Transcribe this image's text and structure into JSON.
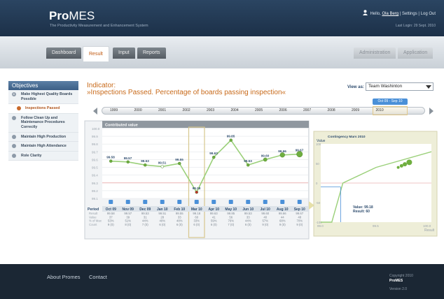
{
  "header": {
    "logo_bold": "Pro",
    "logo_light": "MES",
    "tagline": "The Productivity Measurement and Enhancement System",
    "hello": "Hello,",
    "user": "Ola Berg",
    "sep": "|",
    "settings": "Settings",
    "logout": "Log Out",
    "last_login": "Last Login: 29 Sept. 2010"
  },
  "tabs": {
    "dashboard": "Dashboard",
    "result": "Result",
    "input": "Input",
    "reports": "Reports",
    "administration": "Administration",
    "application": "Application"
  },
  "sidebar": {
    "title": "Objectives",
    "items": [
      {
        "label": "Make Highest Quality Boards Possible",
        "marker": "C"
      },
      {
        "label": "Inspections Passed",
        "marker": ""
      },
      {
        "label": "Follow Clean Up and Maintenance Procedures Correctly",
        "marker": ""
      },
      {
        "label": "Maintain High Production",
        "marker": ""
      },
      {
        "label": "Maintain High Attendance",
        "marker": ""
      },
      {
        "label": "Role Clarity",
        "marker": ""
      }
    ]
  },
  "indicator": {
    "label": "Indicator:",
    "title": "»Inspections Passed. Percentage of boards passing inspection«"
  },
  "view": {
    "label": "View as:",
    "value": "Team Washinton"
  },
  "timeline": {
    "years": [
      "1999",
      "2000",
      "2001",
      "2002",
      "2003",
      "2004",
      "2005",
      "2006",
      "2007",
      "2008",
      "2009",
      "2010"
    ],
    "badge": "Oct 09 - Sep 10"
  },
  "chart_data": [
    {
      "type": "line",
      "title": "Contributed value",
      "categories": [
        "Oct 09",
        "Nov 09",
        "Dec 09",
        "Jan 10",
        "Feb 10",
        "Mar 10",
        "Apr 10",
        "May 10",
        "Jun 10",
        "Jul 10",
        "Aug 10",
        "Sep 10"
      ],
      "values": [
        99.58,
        99.57,
        99.53,
        99.51,
        99.55,
        99.18,
        99.63,
        99.85,
        99.53,
        99.6,
        99.66,
        99.67
      ],
      "ylim": [
        99.1,
        100.0
      ],
      "yticks": [
        "100.0",
        "99.9",
        "99.8",
        "99.7",
        "99.6",
        "99.5",
        "99.4",
        "99.3",
        "99.2",
        "99.1"
      ],
      "highlight": "Mar 10",
      "table": {
        "row_labels": [
          "Period",
          "Result",
          "Value",
          "% of Max",
          "Count"
        ],
        "result": [
          "99.58",
          "99.57",
          "99.53",
          "99.51",
          "99.55",
          "99.18",
          "99.63",
          "99.85",
          "99.53",
          "99.60",
          "99.66",
          "99.67"
        ],
        "value": [
          "37",
          "39",
          "31",
          "28",
          "33",
          "60",
          "41",
          "56",
          "33",
          "40",
          "44",
          "48"
        ],
        "pct_max": [
          "53%",
          "51%",
          "44%",
          "40%",
          "48%",
          "33%",
          "59%",
          "76%",
          "44%",
          "57%",
          "68%",
          "70%"
        ],
        "count": [
          "9 (0)",
          "8 (0)",
          "7 (0)",
          "6 (0)",
          "6 (0)",
          "6 (0)",
          "6 (0)",
          "7 (0)",
          "6 (0)",
          "9 (0)",
          "9 (0)",
          "9 (0)"
        ]
      }
    },
    {
      "type": "line",
      "title": "Contingency  Mars 2010",
      "ylabel": "Value",
      "xlabel": "Result",
      "x": [
        99.0,
        99.1,
        99.2,
        99.5,
        100.0
      ],
      "y": [
        -100,
        -100,
        0,
        40,
        80
      ],
      "xticks": [
        "99.0",
        "99.5",
        "100.0"
      ],
      "yticks": [
        "100",
        "50",
        "0",
        "-50",
        "-100"
      ],
      "ylim": [
        -100,
        100
      ],
      "annotation": {
        "value_label": "Value: 99.18",
        "result_label": "Result: 60"
      }
    }
  ],
  "footer": {
    "about": "About Promes",
    "contact": "Contact",
    "copyright": "Copyright 2010",
    "brand": "ProMES",
    "version": "Version 2.0"
  }
}
